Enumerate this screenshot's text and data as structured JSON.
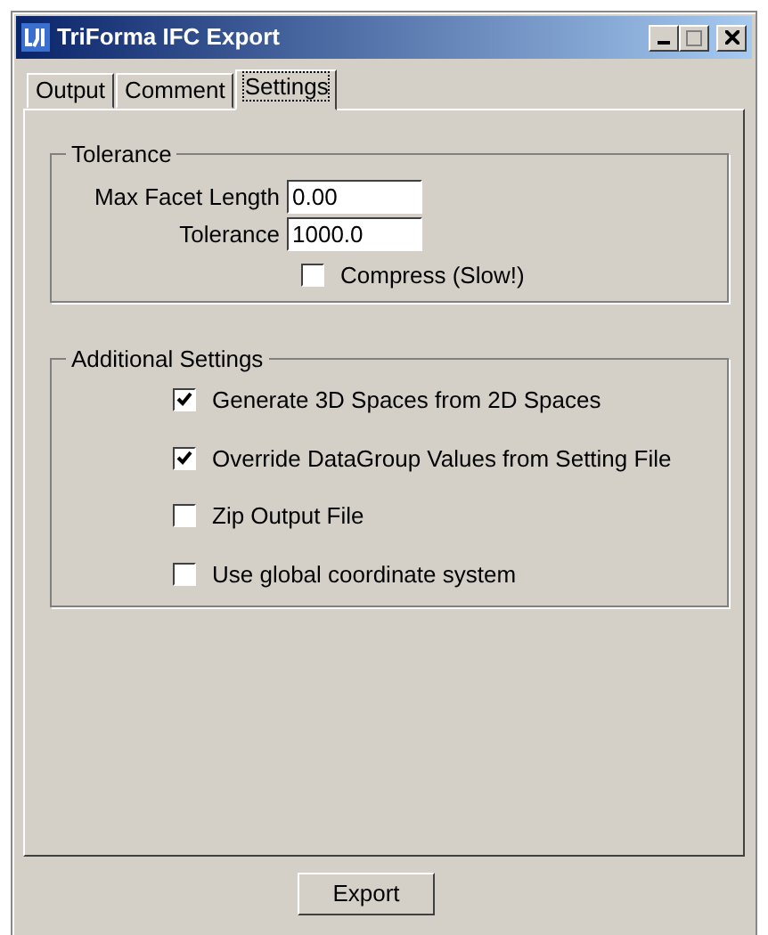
{
  "window": {
    "title": "TriForma IFC Export"
  },
  "tabs": [
    {
      "label": "Output",
      "selected": false
    },
    {
      "label": "Comment",
      "selected": false
    },
    {
      "label": "Settings",
      "selected": true
    }
  ],
  "tolerance_group": {
    "title": "Tolerance",
    "fields": [
      {
        "label": "Max Facet Length",
        "value": "0.00"
      },
      {
        "label": "Tolerance",
        "value": "1000.0"
      }
    ],
    "compress": {
      "label": "Compress (Slow!)",
      "checked": false
    }
  },
  "additional_settings": {
    "title": "Additional Settings",
    "options": [
      {
        "label": "Generate 3D Spaces from 2D Spaces",
        "checked": true
      },
      {
        "label": "Override DataGroup Values from Setting File",
        "checked": true
      },
      {
        "label": "Zip Output File",
        "checked": false
      },
      {
        "label": "Use global coordinate system",
        "checked": false
      }
    ]
  },
  "buttons": [
    "Export"
  ]
}
